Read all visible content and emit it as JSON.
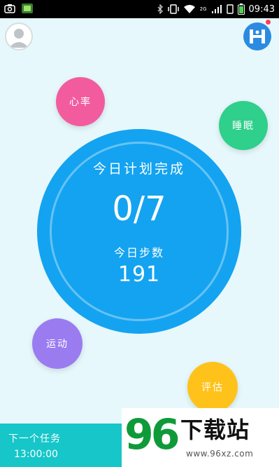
{
  "statusbar": {
    "time": "09:43",
    "network_label": "2G",
    "icons": [
      "screenshot-icon",
      "app-notification-icon",
      "bluetooth-icon",
      "vibrate-icon",
      "wifi-icon",
      "signal-icon",
      "sim-icon",
      "battery-icon"
    ]
  },
  "header": {
    "avatar_icon": "user-avatar-icon",
    "logo_icon": "app-logo-h-icon",
    "logo_badge_color": "#ff3b5c"
  },
  "bubbles": {
    "heart_rate": "心率",
    "sleep": "睡眠",
    "sport": "运动",
    "evaluate": "评估"
  },
  "summary": {
    "plan_label": "今日计划完成",
    "plan_value": "0/7",
    "steps_label": "今日步数",
    "steps_value": "191"
  },
  "next_task": {
    "label": "下一个任务",
    "time": "13:00:00"
  },
  "watermark": {
    "number": "96",
    "text": "下载站",
    "url": "www.96xz.com"
  },
  "colors": {
    "background": "#e6f8fb",
    "main_circle": "#14a3f0",
    "heart": "#f25c9f",
    "sleep": "#2fcf8c",
    "sport": "#9a7cf0",
    "evaluate": "#ffc21a",
    "next_task": "#16c6c9",
    "logo": "#2b8be0"
  }
}
